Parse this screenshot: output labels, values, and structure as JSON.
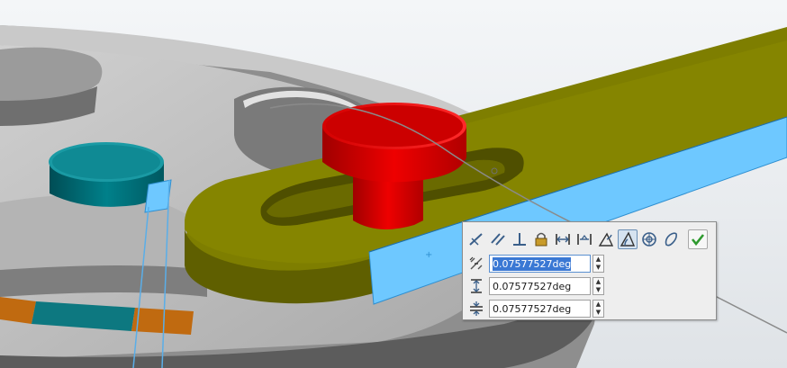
{
  "toolbar": {
    "buttons": [
      {
        "icon": "coincident-icon"
      },
      {
        "icon": "parallel-icon"
      },
      {
        "icon": "perpendicular-icon"
      },
      {
        "icon": "lock-icon"
      },
      {
        "icon": "distance-icon"
      },
      {
        "icon": "angle-distance-icon"
      },
      {
        "icon": "path-mate-icon"
      },
      {
        "icon": "angle-icon",
        "active": true
      },
      {
        "icon": "concentric-icon"
      },
      {
        "icon": "cam-icon"
      }
    ],
    "confirm_icon": "checkmark-icon"
  },
  "fields": {
    "angle": {
      "icon": "angle-dimension-icon",
      "value": "0.07577527deg"
    },
    "max_limit": {
      "icon": "upper-limit-icon",
      "value": "0.07577527deg"
    },
    "min_limit": {
      "icon": "lower-limit-icon",
      "value": "0.07577527deg"
    }
  },
  "colors": {
    "arm_olive": "#6b6b00",
    "pin_red": "#e00000",
    "knob_teal": "#00707a",
    "selected_face": "#6ec8ff",
    "panel_bg": "#eeeeee",
    "selection_highlight": "#3a78d4"
  }
}
